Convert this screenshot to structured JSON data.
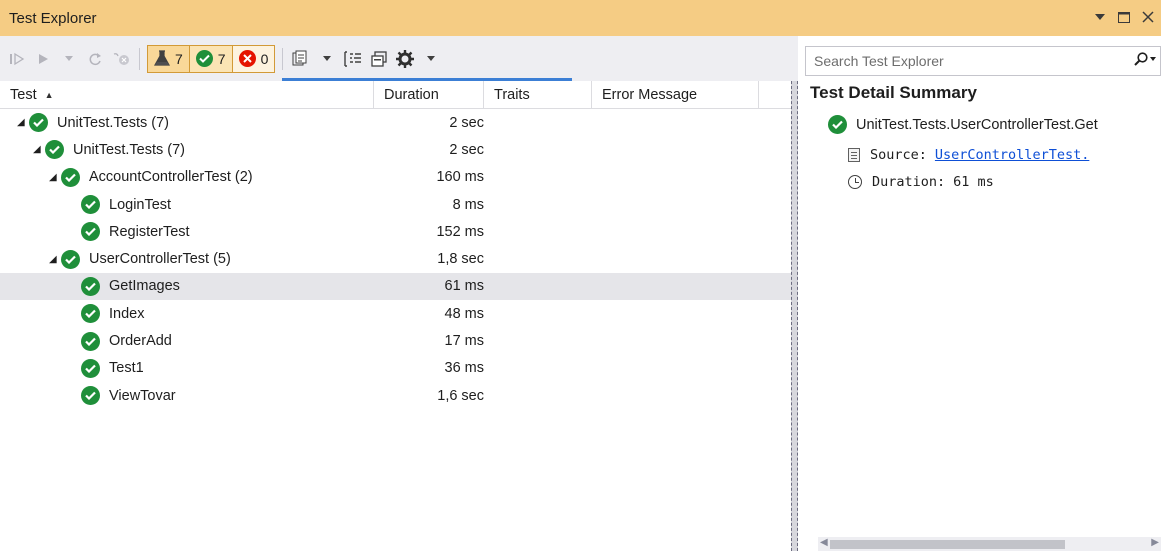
{
  "window": {
    "title": "Test Explorer",
    "controls": [
      "dropdown",
      "maximize",
      "close"
    ]
  },
  "toolbar": {
    "counts": {
      "total": "7",
      "passed": "7",
      "failed": "0"
    }
  },
  "search": {
    "placeholder": "Search Test Explorer"
  },
  "columns": {
    "test": "Test",
    "duration": "Duration",
    "traits": "Traits",
    "error": "Error Message"
  },
  "tests": [
    {
      "name": "UnitTest.Tests (7)",
      "duration": "2 sec"
    },
    {
      "name": "UnitTest.Tests (7)",
      "duration": "2 sec"
    },
    {
      "name": "AccountControllerTest (2)",
      "duration": "160 ms"
    },
    {
      "name": "LoginTest",
      "duration": "8 ms"
    },
    {
      "name": "RegisterTest",
      "duration": "152 ms"
    },
    {
      "name": "UserControllerTest (5)",
      "duration": "1,8 sec"
    },
    {
      "name": "GetImages",
      "duration": "61 ms"
    },
    {
      "name": "Index",
      "duration": "48 ms"
    },
    {
      "name": "OrderAdd",
      "duration": "17 ms"
    },
    {
      "name": "Test1",
      "duration": "36 ms"
    },
    {
      "name": "ViewTovar",
      "duration": "1,6 sec"
    }
  ],
  "detail": {
    "heading": "Test Detail Summary",
    "test_name": "UnitTest.Tests.UserControllerTest.Get",
    "source_label": "Source:",
    "source_link": "UserControllerTest.",
    "duration_label": "Duration:",
    "duration_value": "61 ms"
  },
  "colors": {
    "title_bar": "#f5cc84",
    "pass_green": "#1f8f3a",
    "fail_red": "#e51400",
    "selection": "#e5e5e9",
    "link": "#0e4fd6"
  }
}
